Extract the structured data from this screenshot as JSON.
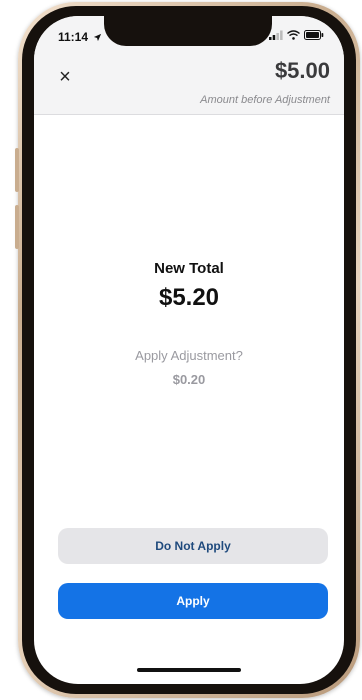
{
  "status_bar": {
    "time": "11:14",
    "location_icon": "location-arrow-icon",
    "signal_icon": "cellular-signal-icon",
    "wifi_icon": "wifi-icon",
    "battery_icon": "battery-icon"
  },
  "header": {
    "close_icon": "close-icon",
    "close_glyph": "×",
    "amount": "$5.00",
    "amount_caption": "Amount before Adjustment"
  },
  "main": {
    "new_total_label": "New Total",
    "new_total_value": "$5.20",
    "adjustment_question": "Apply Adjustment?",
    "adjustment_value": "$0.20"
  },
  "actions": {
    "do_not_apply_label": "Do Not Apply",
    "apply_label": "Apply"
  },
  "colors": {
    "primary": "#1473e6",
    "secondary_bg": "#e5e5e8",
    "secondary_text": "#1f4a7d",
    "header_bg": "#f4f4f5"
  }
}
